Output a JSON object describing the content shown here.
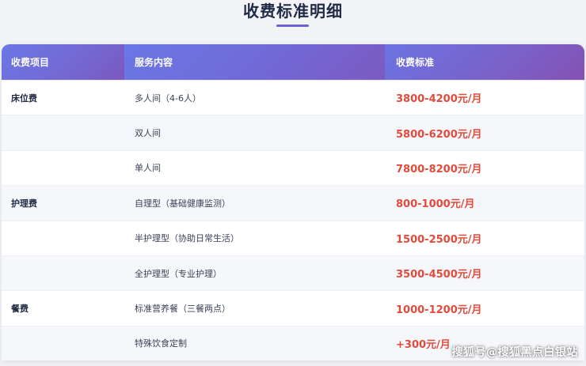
{
  "page": {
    "title": "收费标准明细"
  },
  "table": {
    "headers": [
      "收费项目",
      "服务内容",
      "收费标准"
    ],
    "rows": [
      {
        "category": "床位费",
        "service": "多人间（4-6人）",
        "price": "3800-4200元/月"
      },
      {
        "category": "",
        "service": "双人间",
        "price": "5800-6200元/月"
      },
      {
        "category": "",
        "service": "单人间",
        "price": "7800-8200元/月"
      },
      {
        "category": "护理费",
        "service": "自理型（基础健康监测）",
        "price": "800-1000元/月"
      },
      {
        "category": "",
        "service": "半护理型（协助日常生活）",
        "price": "1500-2500元/月"
      },
      {
        "category": "",
        "service": "全护理型（专业护理）",
        "price": "3500-4500元/月"
      },
      {
        "category": "餐费",
        "service": "标准营养餐（三餐两点）",
        "price": "1000-1200元/月"
      },
      {
        "category": "",
        "service": "特殊饮食定制",
        "price": "+300元/月"
      }
    ]
  },
  "watermark": {
    "text": "搜狐号@搜狐黑点白银站"
  },
  "colors": {
    "accent": "#6b62d6",
    "price": "#e14b3b",
    "heading": "#1f2a44"
  }
}
